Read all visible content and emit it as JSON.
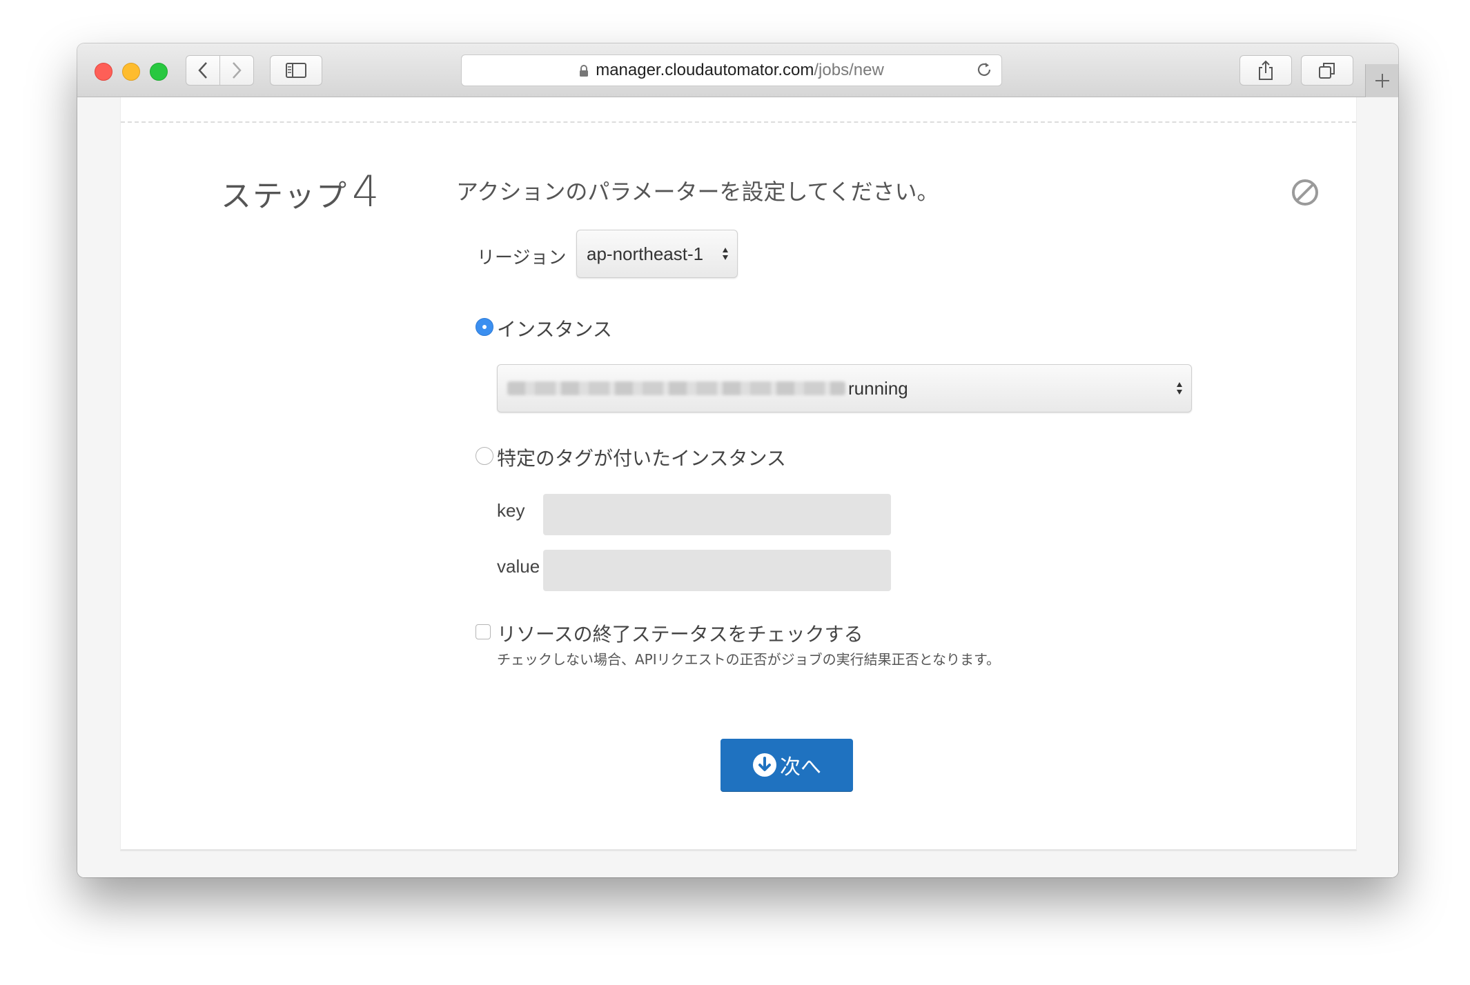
{
  "browser": {
    "url_host": "manager.cloudautomator.com",
    "url_path": "/jobs/new"
  },
  "step": {
    "label": "ステップ",
    "number": "4",
    "instruction": "アクションのパラメーターを設定してください。"
  },
  "form": {
    "region_label": "リージョン",
    "region_value": "ap-northeast-1",
    "instance_radio_label": "インスタンス",
    "instance_radio_selected": true,
    "instance_select_value": "running",
    "tagged_radio_label": "特定のタグが付いたインスタンス",
    "tagged_radio_selected": false,
    "key_label": "key",
    "key_value": "",
    "value_label": "value",
    "value_value": "",
    "check_status_label": "リソースの終了ステータスをチェックする",
    "check_status_checked": false,
    "check_status_note": "チェックしない場合、APIリクエストの正否がジョブの実行結果正否となります。"
  },
  "actions": {
    "next_label": "次へ"
  },
  "colors": {
    "accent": "#1f72c0",
    "radio_selected": "#3b8ff0"
  }
}
